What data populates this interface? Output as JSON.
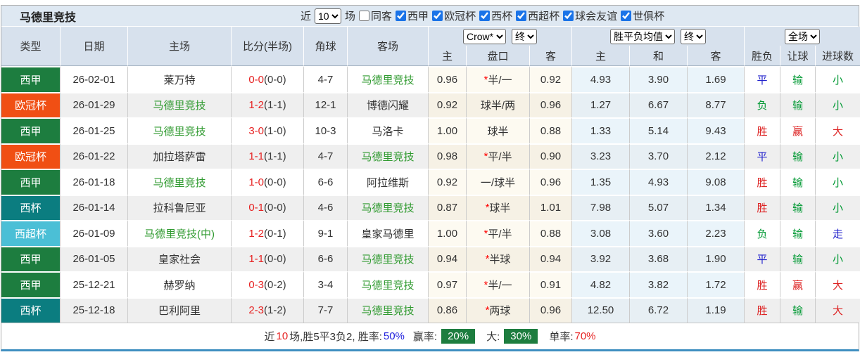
{
  "title": "马德里竞技",
  "toolbar": {
    "recent_label": "近",
    "recent_value": "10",
    "games_label": "场",
    "filters": [
      {
        "label": "同客",
        "checked": false
      },
      {
        "label": "西甲",
        "checked": true
      },
      {
        "label": "欧冠杯",
        "checked": true
      },
      {
        "label": "西杯",
        "checked": true
      },
      {
        "label": "西超杯",
        "checked": true
      },
      {
        "label": "球会友谊",
        "checked": true
      },
      {
        "label": "世俱杯",
        "checked": true
      }
    ]
  },
  "controls": {
    "bookmaker": "Crow*",
    "ah_state": "终",
    "eu_metric": "胜平负均值",
    "eu_state": "终",
    "scope": "全场"
  },
  "columns": {
    "type": "类型",
    "date": "日期",
    "home": "主场",
    "score": "比分(半场)",
    "corner": "角球",
    "away": "客场",
    "ah_home": "主",
    "handicap": "盘口",
    "ah_away": "客",
    "eu_home": "主",
    "eu_draw": "和",
    "eu_away": "客",
    "result": "胜负",
    "let_ball": "让球",
    "goals": "进球数"
  },
  "colors": {
    "laliga_badge": "#1d7d3f",
    "ucl_badge": "#f04f14",
    "copa_badge": "#0b7d80",
    "supercopa_badge": "#4bbfd6",
    "team_link_green": "#2f9a2f",
    "score_red": "#e62222",
    "win_red": "#dd2222",
    "draw_blue": "#2323cc",
    "lose_green": "#009933",
    "rate_blue": "#2222dd",
    "rate_red": "#e62222",
    "badge_bg_green": "#1d7d3f",
    "checkbox_blue": "#1a73e8"
  },
  "rows": [
    {
      "type": "西甲",
      "type_color": "green",
      "date": "26-02-01",
      "home": "莱万特",
      "home_color": "black",
      "score": "0-0",
      "half": "(0-0)",
      "corner": "4-7",
      "away": "马德里竞技",
      "away_color": "green",
      "ah_home": "0.96",
      "star": "*",
      "handicap": "半/一",
      "ah_away": "0.92",
      "eu_home": "4.93",
      "eu_draw": "3.90",
      "eu_away": "1.69",
      "result": "平",
      "result_color": "blue",
      "let_ball": "输",
      "let_color": "green",
      "goals": "小",
      "goals_color": "green"
    },
    {
      "type": "欧冠杯",
      "type_color": "orange",
      "date": "26-01-29",
      "home": "马德里竞技",
      "home_color": "green",
      "score": "1-2",
      "half": "(1-1)",
      "corner": "12-1",
      "away": "博德闪耀",
      "away_color": "black",
      "ah_home": "0.92",
      "star": "",
      "handicap": "球半/两",
      "ah_away": "0.96",
      "eu_home": "1.27",
      "eu_draw": "6.67",
      "eu_away": "8.77",
      "result": "负",
      "result_color": "green",
      "let_ball": "输",
      "let_color": "green",
      "goals": "小",
      "goals_color": "green"
    },
    {
      "type": "西甲",
      "type_color": "green",
      "date": "26-01-25",
      "home": "马德里竞技",
      "home_color": "green",
      "score": "3-0",
      "half": "(1-0)",
      "corner": "10-3",
      "away": "马洛卡",
      "away_color": "black",
      "ah_home": "1.00",
      "star": "",
      "handicap": "球半",
      "ah_away": "0.88",
      "eu_home": "1.33",
      "eu_draw": "5.14",
      "eu_away": "9.43",
      "result": "胜",
      "result_color": "red",
      "let_ball": "赢",
      "let_color": "red",
      "goals": "大",
      "goals_color": "red"
    },
    {
      "type": "欧冠杯",
      "type_color": "orange",
      "date": "26-01-22",
      "home": "加拉塔萨雷",
      "home_color": "black",
      "score": "1-1",
      "half": "(1-1)",
      "corner": "4-7",
      "away": "马德里竞技",
      "away_color": "green",
      "ah_home": "0.98",
      "star": "*",
      "handicap": "平/半",
      "ah_away": "0.90",
      "eu_home": "3.23",
      "eu_draw": "3.70",
      "eu_away": "2.12",
      "result": "平",
      "result_color": "blue",
      "let_ball": "输",
      "let_color": "green",
      "goals": "小",
      "goals_color": "green"
    },
    {
      "type": "西甲",
      "type_color": "green",
      "date": "26-01-18",
      "home": "马德里竞技",
      "home_color": "green",
      "score": "1-0",
      "half": "(0-0)",
      "corner": "6-6",
      "away": "阿拉维斯",
      "away_color": "black",
      "ah_home": "0.92",
      "star": "",
      "handicap": "一/球半",
      "ah_away": "0.96",
      "eu_home": "1.35",
      "eu_draw": "4.93",
      "eu_away": "9.08",
      "result": "胜",
      "result_color": "red",
      "let_ball": "输",
      "let_color": "green",
      "goals": "小",
      "goals_color": "green"
    },
    {
      "type": "西杯",
      "type_color": "teal",
      "date": "26-01-14",
      "home": "拉科鲁尼亚",
      "home_color": "black",
      "score": "0-1",
      "half": "(0-0)",
      "corner": "4-6",
      "away": "马德里竞技",
      "away_color": "green",
      "ah_home": "0.87",
      "star": "*",
      "handicap": "球半",
      "ah_away": "1.01",
      "eu_home": "7.98",
      "eu_draw": "5.07",
      "eu_away": "1.34",
      "result": "胜",
      "result_color": "red",
      "let_ball": "输",
      "let_color": "green",
      "goals": "小",
      "goals_color": "green"
    },
    {
      "type": "西超杯",
      "type_color": "cyan",
      "date": "26-01-09",
      "home": "马德里竞技(中)",
      "home_color": "green",
      "score": "1-2",
      "half": "(0-1)",
      "corner": "9-1",
      "away": "皇家马德里",
      "away_color": "black",
      "ah_home": "1.00",
      "star": "*",
      "handicap": "平/半",
      "ah_away": "0.88",
      "eu_home": "3.08",
      "eu_draw": "3.60",
      "eu_away": "2.23",
      "result": "负",
      "result_color": "green",
      "let_ball": "输",
      "let_color": "green",
      "goals": "走",
      "goals_color": "blue"
    },
    {
      "type": "西甲",
      "type_color": "green",
      "date": "26-01-05",
      "home": "皇家社会",
      "home_color": "black",
      "score": "1-1",
      "half": "(0-0)",
      "corner": "6-6",
      "away": "马德里竞技",
      "away_color": "green",
      "ah_home": "0.94",
      "star": "*",
      "handicap": "半球",
      "ah_away": "0.94",
      "eu_home": "3.92",
      "eu_draw": "3.68",
      "eu_away": "1.90",
      "result": "平",
      "result_color": "blue",
      "let_ball": "输",
      "let_color": "green",
      "goals": "小",
      "goals_color": "green"
    },
    {
      "type": "西甲",
      "type_color": "green",
      "date": "25-12-21",
      "home": "赫罗纳",
      "home_color": "black",
      "score": "0-3",
      "half": "(0-2)",
      "corner": "3-4",
      "away": "马德里竞技",
      "away_color": "green",
      "ah_home": "0.97",
      "star": "*",
      "handicap": "半/一",
      "ah_away": "0.91",
      "eu_home": "4.82",
      "eu_draw": "3.82",
      "eu_away": "1.72",
      "result": "胜",
      "result_color": "red",
      "let_ball": "赢",
      "let_color": "red",
      "goals": "大",
      "goals_color": "red"
    },
    {
      "type": "西杯",
      "type_color": "teal",
      "date": "25-12-18",
      "home": "巴利阿里",
      "home_color": "black",
      "score": "2-3",
      "half": "(1-2)",
      "corner": "7-7",
      "away": "马德里竞技",
      "away_color": "green",
      "ah_home": "0.86",
      "star": "*",
      "handicap": "两球",
      "ah_away": "0.96",
      "eu_home": "12.50",
      "eu_draw": "6.72",
      "eu_away": "1.19",
      "result": "胜",
      "result_color": "red",
      "let_ball": "输",
      "let_color": "green",
      "goals": "大",
      "goals_color": "red"
    }
  ],
  "footer": {
    "part1": "近",
    "recent_count": "10",
    "part2": "场,胜5平3负2, 胜率:",
    "win_rate": "50%",
    "win_odds_label": "赢率:",
    "win_odds": "20%",
    "big_label": "大:",
    "big_rate": "30%",
    "single_label": "单率:",
    "single_rate": "70%"
  }
}
